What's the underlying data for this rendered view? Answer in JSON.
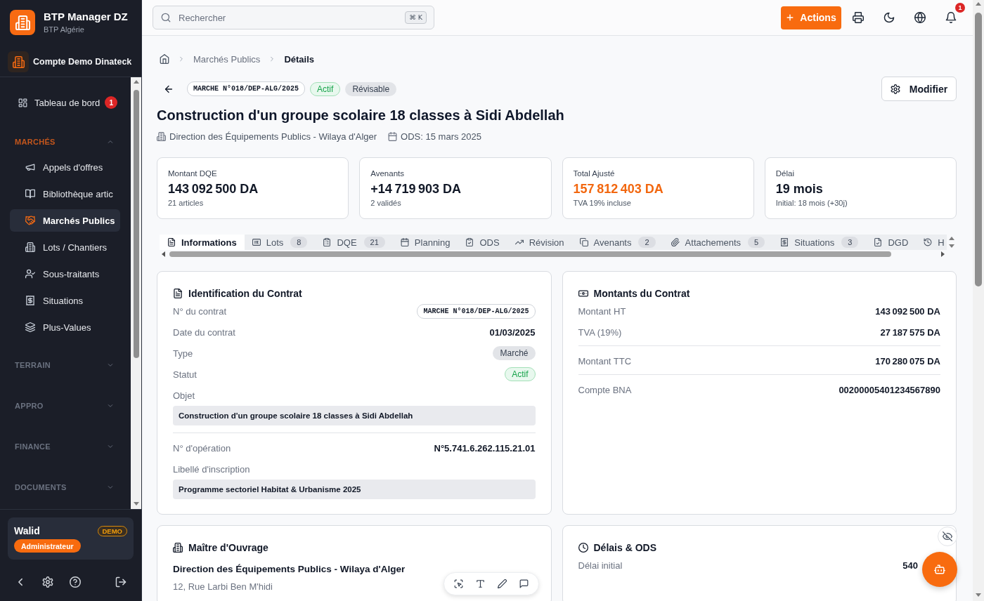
{
  "sidebar": {
    "brand": {
      "title": "BTP Manager DZ",
      "subtitle": "BTP Algérie"
    },
    "account": "Compte Demo Dinateck",
    "items": [
      {
        "label": "Tableau de bord",
        "badge": "1",
        "selected": false
      }
    ],
    "sections": [
      {
        "title": "MARCHÉS",
        "expanded": true,
        "items": [
          {
            "label": "Appels d'offres",
            "selected": false
          },
          {
            "label": "Bibliothèque artic",
            "selected": false
          },
          {
            "label": "Marchés Publics",
            "selected": true
          },
          {
            "label": "Lots / Chantiers",
            "selected": false
          },
          {
            "label": "Sous-traitants",
            "selected": false
          },
          {
            "label": "Situations",
            "selected": false
          },
          {
            "label": "Plus-Values",
            "selected": false
          }
        ]
      },
      {
        "title": "TERRAIN",
        "expanded": false
      },
      {
        "title": "APPRO",
        "expanded": false
      },
      {
        "title": "FINANCE",
        "expanded": false
      },
      {
        "title": "DOCUMENTS",
        "expanded": false
      }
    ],
    "user": {
      "name": "Walid",
      "tag": "DEMO",
      "role": "Administrateur"
    }
  },
  "topbar": {
    "search": {
      "placeholder": "Rechercher",
      "shortcut": "⌘ K"
    },
    "action_button": "Actions",
    "notification_count": "1"
  },
  "breadcrumb": [
    {
      "label": "Marchés Publics",
      "current": false
    },
    {
      "label": "Détails",
      "current": true
    }
  ],
  "header": {
    "code": "MARCHE N°018/DEP-ALG/2025",
    "tags": [
      {
        "label": "Actif",
        "kind": "success"
      },
      {
        "label": "Révisable",
        "kind": "neutral"
      }
    ],
    "edit_button": "Modifier",
    "title": "Construction d'un groupe scolaire 18 classes à Sidi Abdellah",
    "meta": [
      "Direction des Équipements Publics - Wilaya d'Alger",
      "ODS: 15 mars 2025"
    ]
  },
  "stats": [
    {
      "label": "Montant DQE",
      "value": "143 092 500 DA",
      "note": "21 articles",
      "highlight": false
    },
    {
      "label": "Avenants",
      "value": "+14 719 903 DA",
      "note": "2 validés",
      "highlight": false
    },
    {
      "label": "Total Ajusté",
      "value": "157 812 403 DA",
      "note": "TVA 19% incluse",
      "highlight": true
    },
    {
      "label": "Délai",
      "value": "19 mois",
      "note": "Initial: 18 mois (+30j)",
      "highlight": false
    }
  ],
  "tabs": [
    {
      "label": "Informations",
      "selected": true
    },
    {
      "label": "Lots",
      "count": "8",
      "selected": false
    },
    {
      "label": "DQE",
      "count": "21",
      "selected": false
    },
    {
      "label": "Planning",
      "selected": false
    },
    {
      "label": "ODS",
      "selected": false
    },
    {
      "label": "Révision",
      "selected": false
    },
    {
      "label": "Avenants",
      "count": "2",
      "selected": false
    },
    {
      "label": "Attachements",
      "count": "5",
      "selected": false
    },
    {
      "label": "Situations",
      "count": "3",
      "selected": false
    },
    {
      "label": "DGD",
      "selected": false
    },
    {
      "label": "H",
      "selected": false
    }
  ],
  "cards": [
    {
      "kind": "fields",
      "title": "Identification du Contrat",
      "groups": [
        [
          {
            "kind": "code",
            "label": "N° du contrat",
            "value": "MARCHE N°018/DEP-ALG/2025"
          },
          {
            "kind": "text",
            "label": "Date du contrat",
            "value": "01/03/2025"
          },
          {
            "kind": "tag",
            "label": "Type",
            "value": "Marché"
          },
          {
            "kind": "status",
            "label": "Statut",
            "value": "Actif"
          },
          {
            "kind": "block",
            "label": "Objet",
            "value": "Construction d'un groupe scolaire 18 classes à Sidi Abdellah"
          }
        ],
        [
          {
            "kind": "text",
            "label": "N° d'opération",
            "value": "N°5.741.6.262.115.21.01"
          },
          {
            "kind": "block",
            "label": "Libellé d'inscription",
            "value": "Programme sectoriel Habitat & Urbanisme 2025"
          }
        ]
      ]
    },
    {
      "kind": "fields",
      "title": "Montants du Contrat",
      "groups": [
        [
          {
            "kind": "text",
            "label": "Montant HT",
            "value": "143 092 500 DA"
          },
          {
            "kind": "text",
            "label": "TVA (19%)",
            "value": "27 187 575 DA"
          }
        ],
        [
          {
            "kind": "text",
            "label": "Montant TTC",
            "value": "170 280 075 DA"
          }
        ],
        [
          {
            "kind": "text",
            "label": "Compte BNA",
            "value": "00200005401234567890"
          }
        ]
      ]
    },
    {
      "kind": "contact",
      "title": "Maître d'Ouvrage",
      "name": "Direction des Équipements Publics - Wilaya d'Alger",
      "address": "12, Rue Larbi Ben M'hidi"
    },
    {
      "kind": "fields",
      "title": "Délais & ODS",
      "groups": [
        [
          {
            "kind": "text",
            "label": "Délai initial",
            "value": "540"
          }
        ]
      ]
    }
  ]
}
